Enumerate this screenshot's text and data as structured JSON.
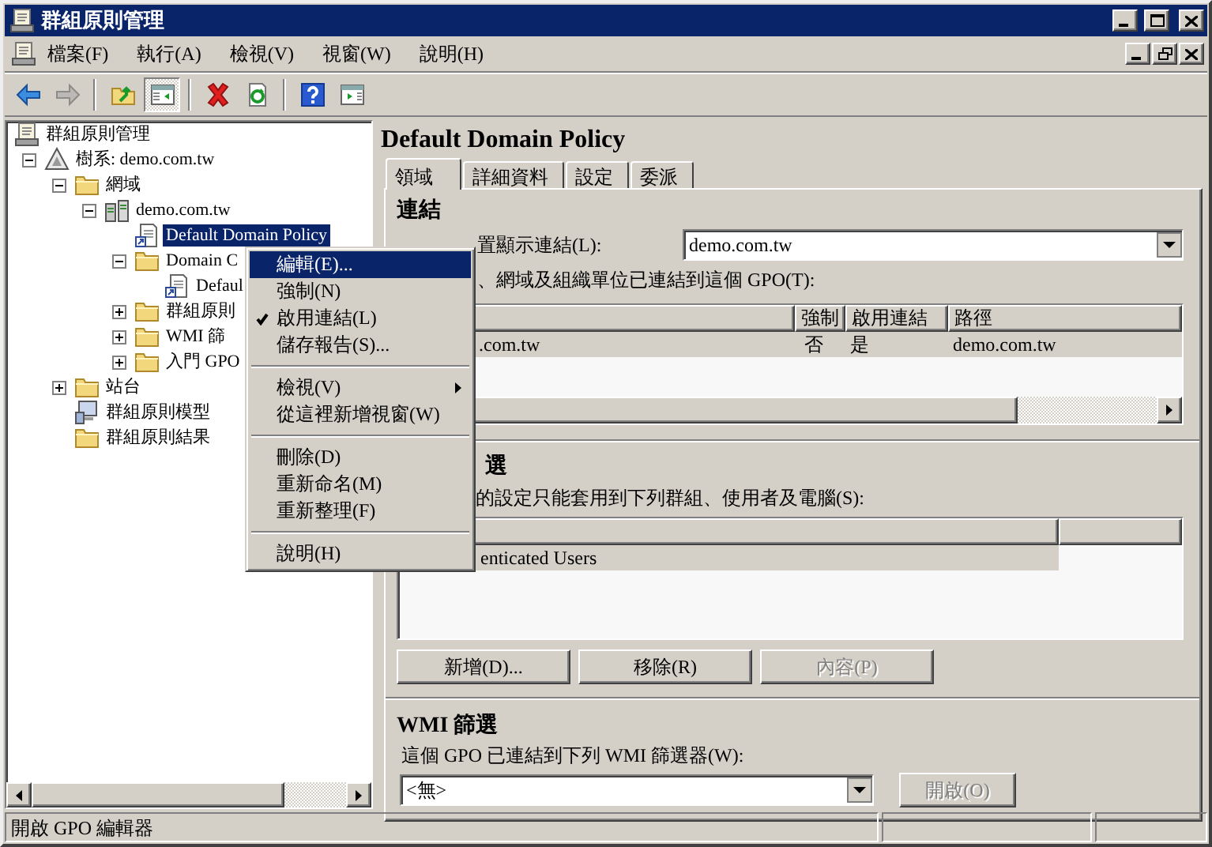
{
  "window": {
    "title": "群組原則管理"
  },
  "menu_bar": [
    "檔案(F)",
    "執行(A)",
    "檢視(V)",
    "視窗(W)",
    "說明(H)"
  ],
  "toolbar": [
    [
      {
        "kind": "back",
        "disabled": false,
        "pressed": false
      },
      {
        "kind": "forward",
        "disabled": true,
        "pressed": false
      }
    ],
    [
      {
        "kind": "up",
        "disabled": false,
        "pressed": false
      },
      {
        "kind": "tree",
        "disabled": false,
        "pressed": true
      }
    ],
    [
      {
        "kind": "delete",
        "disabled": false,
        "pressed": false
      },
      {
        "kind": "refresh",
        "disabled": false,
        "pressed": false
      }
    ],
    [
      {
        "kind": "help",
        "disabled": false,
        "pressed": false
      },
      {
        "kind": "pane",
        "disabled": false,
        "pressed": false
      }
    ]
  ],
  "tree": [
    {
      "label": "群組原則管理",
      "kind": "console",
      "selected": false,
      "children": [
        {
          "label": "樹系: demo.com.tw",
          "kind": "forest",
          "selected": false,
          "expanded": true,
          "children": [
            {
              "label": "網域",
              "kind": "folder",
              "selected": false,
              "expanded": true,
              "children": [
                {
                  "label": "demo.com.tw",
                  "kind": "domain",
                  "selected": false,
                  "expanded": true,
                  "children": [
                    {
                      "label": "Default Domain Policy",
                      "kind": "gpo",
                      "selected": true
                    },
                    {
                      "label": "Domain C",
                      "kind": "folder",
                      "selected": false,
                      "expanded": true,
                      "children": [
                        {
                          "label": "Defaul",
                          "kind": "gpo",
                          "selected": false
                        }
                      ]
                    },
                    {
                      "label": "群組原則",
                      "kind": "folder",
                      "selected": false,
                      "expanded": false
                    },
                    {
                      "label": "WMI 篩",
                      "kind": "folder",
                      "selected": false,
                      "expanded": false
                    },
                    {
                      "label": "入門 GPO",
                      "kind": "folder",
                      "selected": false,
                      "expanded": false
                    }
                  ]
                }
              ]
            },
            {
              "label": "站台",
              "kind": "folder",
              "selected": false,
              "expanded": false
            },
            {
              "label": "群組原則模型",
              "kind": "modeling",
              "selected": false
            },
            {
              "label": "群組原則結果",
              "kind": "folder",
              "selected": false
            }
          ]
        }
      ]
    }
  ],
  "details": {
    "title": "Default Domain Policy",
    "tabs": [
      {
        "label": "領域",
        "selected": true
      },
      {
        "label": "詳細資料",
        "selected": false
      },
      {
        "label": "設定",
        "selected": false
      },
      {
        "label": "委派",
        "selected": false
      }
    ],
    "links": {
      "heading": "連結",
      "location_label": "置顯示連結(L):",
      "location_value": "demo.com.tw",
      "list_label": "、網域及組織單位已連結到這個 GPO(T):",
      "columns": [
        "",
        "強制",
        "啟用連結",
        "路徑"
      ],
      "rows": [
        {
          "cells": [
            ".com.tw",
            "否",
            "是",
            "demo.com.tw"
          ],
          "selected": true
        }
      ]
    },
    "security_filtering": {
      "heading": "選",
      "label": "的設定只能套用到下列群組、使用者及電腦(S):",
      "rows": [
        {
          "name": "enticated Users",
          "selected": true
        }
      ],
      "buttons": [
        {
          "label": "新增(D)...",
          "disabled": false
        },
        {
          "label": "移除(R)",
          "disabled": false
        },
        {
          "label": "內容(P)",
          "disabled": true
        }
      ]
    },
    "wmi_filtering": {
      "heading": "WMI 篩選",
      "label": "這個 GPO 已連結到下列 WMI 篩選器(W):",
      "value": "<無>",
      "button": {
        "label": "開啟(O)",
        "disabled": true
      }
    }
  },
  "context_menu": [
    [
      {
        "label": "編輯(E)...",
        "selected": true,
        "checked": false,
        "submenu": false
      },
      {
        "label": "強制(N)",
        "selected": false,
        "checked": false,
        "submenu": false
      },
      {
        "label": "啟用連結(L)",
        "selected": false,
        "checked": true,
        "submenu": false
      },
      {
        "label": "儲存報告(S)...",
        "selected": false,
        "checked": false,
        "submenu": false
      }
    ],
    [
      {
        "label": "檢視(V)",
        "selected": false,
        "checked": false,
        "submenu": true
      },
      {
        "label": "從這裡新增視窗(W)",
        "selected": false,
        "checked": false,
        "submenu": false
      }
    ],
    [
      {
        "label": "刪除(D)",
        "selected": false,
        "checked": false,
        "submenu": false
      },
      {
        "label": "重新命名(M)",
        "selected": false,
        "checked": false,
        "submenu": false
      },
      {
        "label": "重新整理(F)",
        "selected": false,
        "checked": false,
        "submenu": false
      }
    ],
    [
      {
        "label": "說明(H)",
        "selected": false,
        "checked": false,
        "submenu": false
      }
    ]
  ],
  "status_bar": [
    "開啟 GPO 編輯器"
  ]
}
